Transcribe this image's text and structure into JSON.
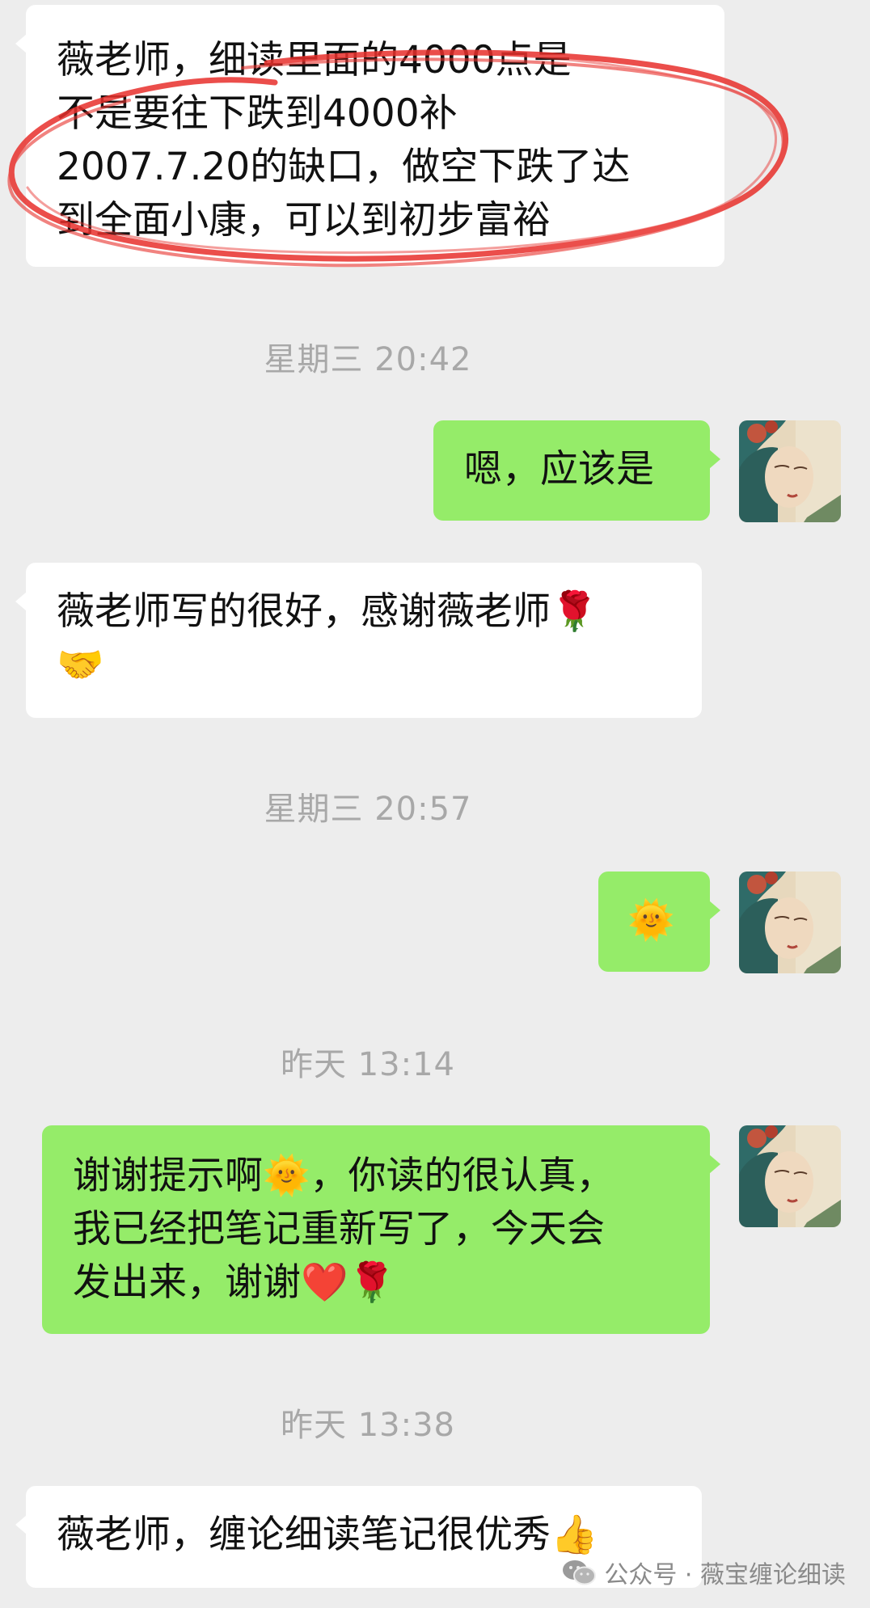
{
  "messages": [
    {
      "side": "left",
      "text": "薇老师，细读里面的4000点是\n不是要往下跌到4000补\n2007.7.20的缺口，做空下跌了达\n到全面小康，可以到初步富裕"
    },
    {
      "side": "right",
      "text": "嗯，应该是"
    },
    {
      "side": "left",
      "text": "薇老师写的很好，感谢薇老师🌹\n🤝"
    },
    {
      "side": "right",
      "text": "🌞"
    },
    {
      "side": "right",
      "text": "谢谢提示啊🌞，你读的很认真，\n我已经把笔记重新写了，今天会\n发出来，谢谢❤️🌹"
    },
    {
      "side": "left",
      "text": "薇老师，缠论细读笔记很优秀👍"
    }
  ],
  "timestamps": [
    "星期三 20:42",
    "星期三 20:57",
    "昨天 13:14",
    "昨天 13:38"
  ],
  "watermark": {
    "text": "公众号 · 薇宝缠论细读",
    "icon": "wechat-icon"
  },
  "annotation": {
    "shape": "hand-drawn-ellipse",
    "color": "#e8302c"
  },
  "colors": {
    "background": "#ededed",
    "left_bubble": "#ffffff",
    "right_bubble": "#95ec69",
    "timestamp": "#a8a8a8",
    "text": "#111111"
  }
}
